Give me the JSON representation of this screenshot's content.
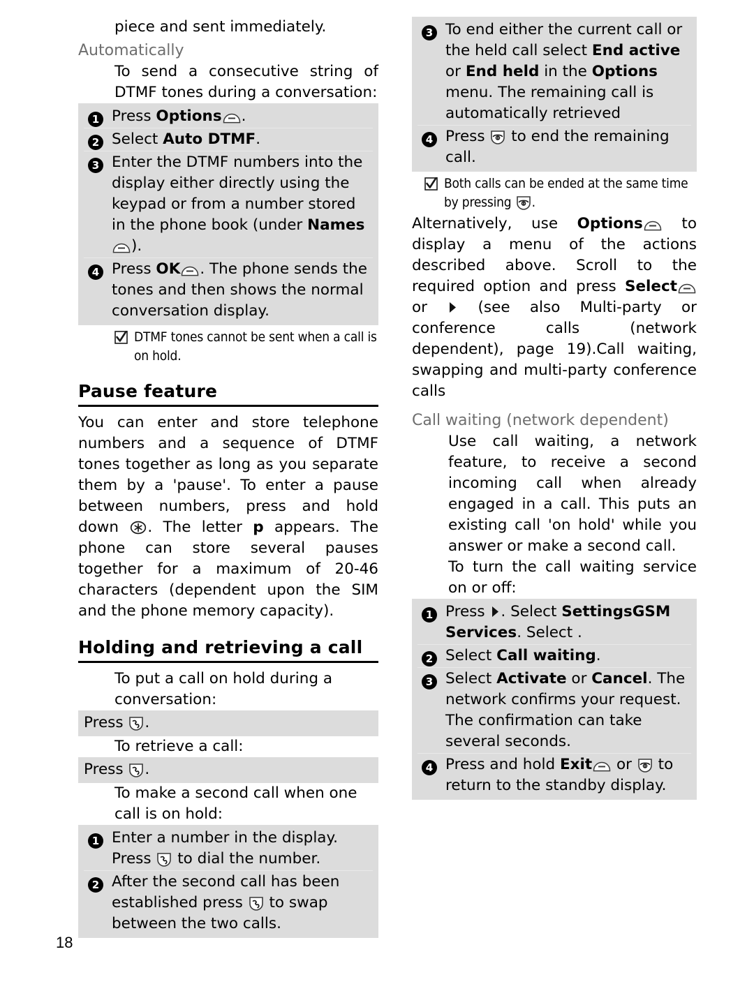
{
  "document": {
    "page_number": "18",
    "colors": {
      "shade_background": "#dcdcdc",
      "subheading_gray": "#6e6e6e",
      "text": "#000000",
      "page_background": "#ffffff"
    }
  },
  "left_column": {
    "continued_line": "piece and sent immediately.",
    "automatically": {
      "subheading": "Automatically",
      "intro": "To send a consecutive string of DTMF tones during a conversation:",
      "steps": [
        {
          "number": "1",
          "text_before": "Press ",
          "bold": "Options",
          "icon": "softkey-icon",
          "text_after": "."
        },
        {
          "number": "2",
          "text_before": "Select ",
          "bold": "Auto DTMF",
          "text_after": "."
        },
        {
          "number": "3",
          "text_before": "Enter the DTMF numbers into the display either directly using the keypad or from a number stored in the phone book (under ",
          "bold": "Names",
          "icon": "softkey-icon",
          "text_after": ")."
        },
        {
          "number": "4",
          "text_before": "Press ",
          "bold": "OK",
          "icon": "softkey-icon",
          "text_after": ". The phone sends the tones and then shows the normal conversation display."
        }
      ],
      "note": "DTMF tones cannot be sent when a call is on hold."
    },
    "pause_feature": {
      "heading": "Pause feature",
      "paragraph_part1": "You can enter and store telephone numbers and a sequence of DTMF tones together as long as you separate them by a 'pause'. To enter a pause between numbers, press and hold down ",
      "icon": "star-key-icon",
      "paragraph_part2": ". The letter ",
      "bold_letter": "p",
      "paragraph_part3": " appears. The phone can store several pauses together for a maximum of 20-46 characters (dependent upon the SIM and the phone memory capacity)."
    },
    "holding": {
      "heading": "Holding and retrieving a call",
      "intro1": "To put a call on hold during a conversation:",
      "shaded1_before": "Press ",
      "shaded1_icon": "call-key-icon",
      "shaded1_after": ".",
      "intro2": "To retrieve a call:",
      "shaded2_before": "Press ",
      "shaded2_icon": "call-key-icon",
      "shaded2_after": ".",
      "intro3": "To make a second call when one call is on hold:",
      "steps": [
        {
          "number": "1",
          "text_before": "Enter a number in the display. Press ",
          "icon": "call-key-icon",
          "text_after": " to dial the number."
        },
        {
          "number": "2",
          "text_before": "After the second call has been established press ",
          "icon": "call-key-icon",
          "text_after": " to swap between the two calls."
        }
      ]
    }
  },
  "right_column": {
    "continued_steps": [
      {
        "number": "3",
        "seg1": "To end either the current call or the held call select ",
        "bold1": "End active",
        "seg2": " or ",
        "bold2": "End held",
        "seg3": " in the ",
        "bold3": "Options",
        "seg4": " menu. The remaining call is automatically retrieved"
      },
      {
        "number": "4",
        "seg1": "Press ",
        "icon": "end-key-icon",
        "seg2": " to end the remaining call."
      }
    ],
    "note_part1": "Both calls can be ended at the same time by pressing ",
    "note_icon": "end-key-icon",
    "note_part2": ".",
    "alternatively": {
      "seg1": "Alternatively, use ",
      "bold1": "Options",
      "icon1": "softkey-icon",
      "seg2": " to display a menu of the actions described above. Scroll to the required option and press ",
      "bold2": "Select",
      "icon2": "softkey-icon",
      "seg3": " or ",
      "icon3": "right-arrow-icon",
      "seg4": " (see also Multi-party or conference calls (network dependent), page 19).Call waiting, swapping and multi-party conference calls"
    },
    "call_waiting": {
      "subheading": "Call waiting (network dependent)",
      "paragraph": "Use call waiting, a network feature, to receive a second incoming call when already engaged in a call. This puts an existing call 'on hold' while you answer or make a second call.",
      "instruction": "To turn the call waiting service on or off:",
      "steps": [
        {
          "number": "1",
          "seg1": "Press ",
          "icon": "right-arrow-icon",
          "seg2": ". Select ",
          "bold1": "Settings",
          "seg3": ". Select ",
          "bold2": "GSM Services",
          "seg4": "."
        },
        {
          "number": "2",
          "seg1": "Select ",
          "bold1": "Call waiting",
          "seg2": "."
        },
        {
          "number": "3",
          "seg1": "Select ",
          "bold1": "Activate",
          "seg2": " or ",
          "bold2": "Cancel",
          "seg3": ". The network confirms your request. The confirmation can take several seconds."
        },
        {
          "number": "4",
          "seg1": "Press and hold ",
          "bold1": "Exit",
          "icon1": "softkey-icon",
          "seg2": " or ",
          "icon2": "end-key-icon",
          "seg3": " to return to the standby display."
        }
      ]
    }
  }
}
